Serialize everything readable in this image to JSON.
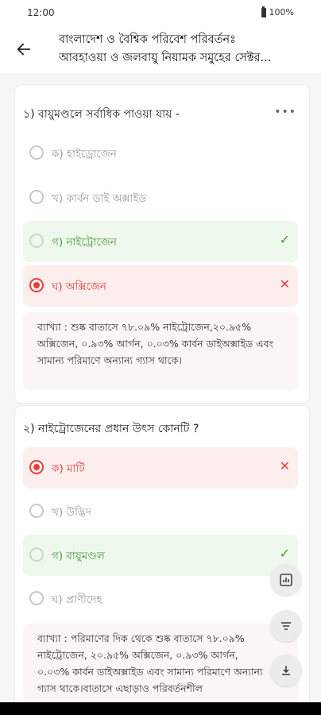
{
  "status": {
    "time": "12:00",
    "battery": "100%"
  },
  "header": {
    "title_line1": "বাংলাদেশ ও বৈশ্বিক পরিবেশ পরিবর্তনঃ",
    "title_line2": "আবহাওয়া ও জলবায়ু নিয়ামক সমুহের সেক্টর..."
  },
  "questions": [
    {
      "text": "১) বায়ুমণ্ডলে সর্বাধিক পাওয়া যায় -",
      "more": "•••",
      "options": [
        {
          "label": "ক) হাইড্রোজেন",
          "state": "normal"
        },
        {
          "label": "খ) কার্বন ডাই অক্সাইড",
          "state": "normal"
        },
        {
          "label": "গ) নাইট্রোজেন",
          "state": "correct"
        },
        {
          "label": "ঘ) অক্সিজেন",
          "state": "wrong-selected"
        }
      ],
      "explanation": "ব্যাখ্যা : শুষ্ক বাতাসে ৭৮.০৯% নাইট্রোজেন,২০.৯৫% অক্সিজেন, ০.৯৩% আর্গন, ০.০৩% কার্বন ডাইঅক্সাইড এবং সামান্য পরিমাণে অন্যান্য গ্যাস থাকে।"
    },
    {
      "text": "২) নাইট্রোজেনের প্রধান উৎস কোনটি ?",
      "more": "•••",
      "options": [
        {
          "label": "ক) মাটি",
          "state": "wrong-selected"
        },
        {
          "label": "খ) উদ্ভিদ",
          "state": "normal"
        },
        {
          "label": "গ) বায়ুমণ্ডল",
          "state": "correct"
        },
        {
          "label": "ঘ) প্রাণীদেহ",
          "state": "normal"
        }
      ],
      "explanation": "ব্যাখ্যা : পরিমাণের দিক থেকে শুষ্ক বাতাসে ৭৮.০৯% নাইট্রোজেন, ২০.৯৫% অক্সিজেন, ০.৯৩% আর্গন, ০.০৩% কার্বন ডাইঅক্সাইড এবং সামান্য পরিমাণে অন্যান্য গ্যাস থাকে।বাতাসে এছাড়াও পরিবর্তনশীল"
    }
  ],
  "marks": {
    "check": "✓",
    "cross": "✕"
  },
  "colors": {
    "correct": "#4b9a3c",
    "wrong": "#e0413a",
    "correct_bg": "#eef8ec",
    "wrong_bg": "#fdeeee"
  },
  "fabs": [
    "stats-icon",
    "filter-icon",
    "download-icon"
  ]
}
